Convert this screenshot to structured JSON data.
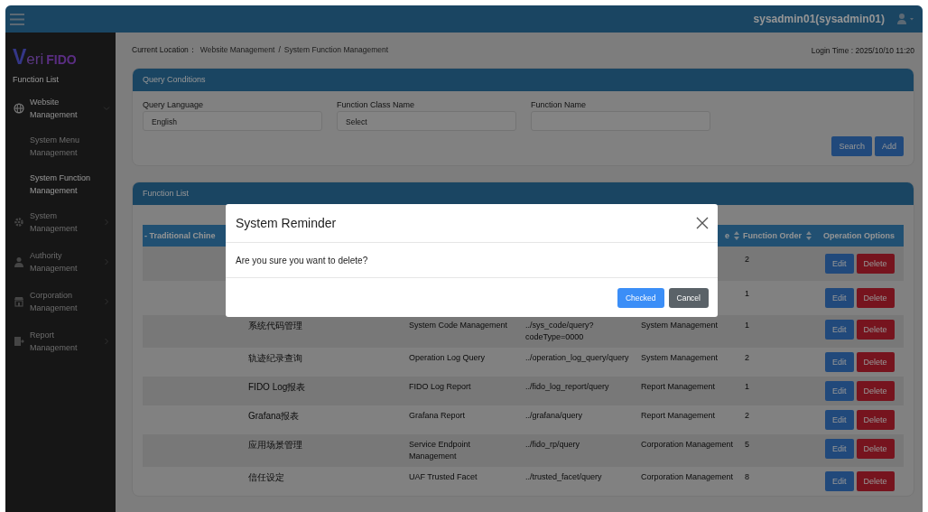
{
  "topbar": {
    "user": "sysadmin01(sysadmin01)"
  },
  "sidebar": {
    "logo": {
      "name": "Veri",
      "brand": "FIDO"
    },
    "heading": "Function List",
    "items": [
      {
        "label": "Website Management",
        "expanded": true,
        "children": [
          {
            "label": "System Menu Management",
            "selected": false
          },
          {
            "label": "System Function Management",
            "selected": true
          }
        ]
      },
      {
        "label": "System Management",
        "expanded": false
      },
      {
        "label": "Authority Management",
        "expanded": false
      },
      {
        "label": "Corporation Management",
        "expanded": false
      },
      {
        "label": "Report Management",
        "expanded": false
      }
    ]
  },
  "breadcrumb": {
    "label": "Current Location：",
    "path": [
      "Website Management",
      "System Function Management"
    ],
    "separator": "/"
  },
  "login_time": "Login Time : 2025/10/10 11:20",
  "query_panel": {
    "title": "Query Conditions",
    "fields": [
      {
        "label": "Query Language",
        "value": "English"
      },
      {
        "label": "Function Class Name",
        "value": "Select"
      },
      {
        "label": "Function Name"
      }
    ],
    "buttons": [
      "Search",
      "Add"
    ]
  },
  "list_panel": {
    "title": "Function List",
    "table": {
      "columns": [
        {
          "label": "- Traditional Chine"
        },
        {},
        {},
        {},
        {
          "label": "e",
          "sortable": true
        },
        {
          "label": "Function Order",
          "sortable": true
        },
        {
          "label": "Operation Options"
        }
      ],
      "rows": [
        {
          "function_order": "2",
          "actions": [
            "Edit",
            "Delete"
          ]
        },
        {
          "function_order": "1",
          "actions": [
            "Edit",
            "Delete"
          ]
        },
        {
          "column_2": "系统代码管理",
          "column_3": "System Code Management",
          "column_4": "../sys_code/query?codeType=0000",
          "column_5": "System Management",
          "function_order": "1",
          "actions": [
            "Edit",
            "Delete"
          ]
        },
        {
          "column_2": "轨迹纪录查询",
          "column_3": "Operation Log Query",
          "column_4": "../operation_log_query/query",
          "column_5": "System Management",
          "function_order": "2",
          "actions": [
            "Edit",
            "Delete"
          ]
        },
        {
          "column_2": "FIDO Log报表",
          "column_3": "FIDO Log Report",
          "column_4": "../fido_log_report/query",
          "column_5": "Report Management",
          "function_order": "1",
          "actions": [
            "Edit",
            "Delete"
          ]
        },
        {
          "column_2": "Grafana报表",
          "column_3": "Grafana Report",
          "column_4": "../grafana/query",
          "column_5": "Report Management",
          "function_order": "2",
          "actions": [
            "Edit",
            "Delete"
          ]
        },
        {
          "column_2": "应用场景管理",
          "column_3": "Service Endpoint Management",
          "column_4": "../fido_rp/query",
          "column_5": "Corporation Management",
          "function_order": "5",
          "actions": [
            "Edit",
            "Delete"
          ]
        },
        {
          "column_2": "信任设定",
          "column_3": "UAF Trusted Facet",
          "column_4": "../trusted_facet/query",
          "column_5": "Corporation Management",
          "function_order": "8",
          "actions": [
            "Edit",
            "Delete"
          ]
        }
      ]
    }
  },
  "modal": {
    "title": "System Reminder",
    "message": "Are you sure you want to delete?",
    "buttons": [
      {
        "label": "Checked",
        "kind": "primary"
      },
      {
        "label": "Cancel",
        "kind": "secondary"
      }
    ]
  }
}
